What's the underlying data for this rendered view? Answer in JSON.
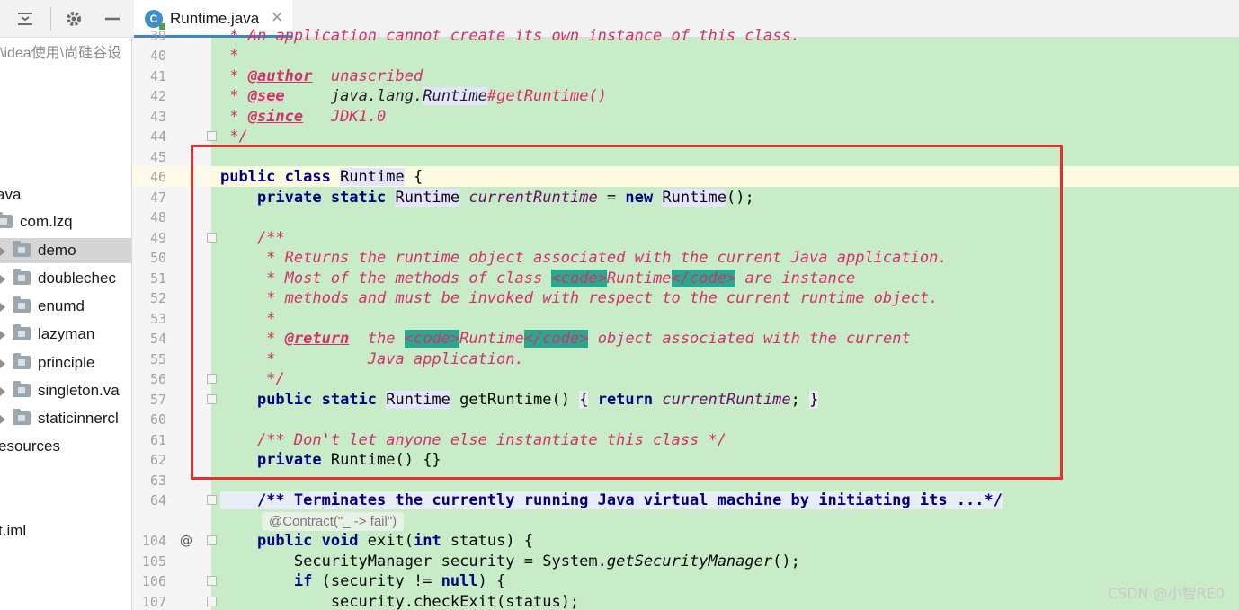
{
  "toolbar": {
    "icons": [
      "collapse-all-icon",
      "gear-icon",
      "minimize-icon"
    ]
  },
  "sidebar": {
    "path": "\\idea使用\\尚硅谷设",
    "items": [
      {
        "label": "ava",
        "kind": "text"
      },
      {
        "label": "com.lzq",
        "kind": "folder-open"
      },
      {
        "label": "demo",
        "kind": "folder",
        "selected": true
      },
      {
        "label": "doublechec",
        "kind": "folder"
      },
      {
        "label": "enumd",
        "kind": "folder"
      },
      {
        "label": "lazyman",
        "kind": "folder"
      },
      {
        "label": "principle",
        "kind": "folder"
      },
      {
        "label": "singleton.va",
        "kind": "folder"
      },
      {
        "label": "staticinnercl",
        "kind": "folder"
      },
      {
        "label": "esources",
        "kind": "text"
      },
      {
        "label": "t.iml",
        "kind": "text"
      }
    ]
  },
  "tab": {
    "title": "Runtime.java",
    "icon_letter": "C",
    "close": "✕"
  },
  "editor": {
    "lines": [
      {
        "n": "39",
        "code": " * An application cannot create its own instance of this class."
      },
      {
        "n": "40",
        "code": " *"
      },
      {
        "n": "41",
        "code": " * @author  unascribed"
      },
      {
        "n": "42",
        "code": " * @see     java.lang.Runtime#getRuntime()"
      },
      {
        "n": "43",
        "code": " * @since   JDK1.0"
      },
      {
        "n": "44",
        "code": " */"
      },
      {
        "n": "45",
        "code": ""
      },
      {
        "n": "46",
        "code": "public class Runtime {"
      },
      {
        "n": "47",
        "code": "    private static Runtime currentRuntime = new Runtime();"
      },
      {
        "n": "48",
        "code": ""
      },
      {
        "n": "49",
        "code": "    /**"
      },
      {
        "n": "50",
        "code": "     * Returns the runtime object associated with the current Java application."
      },
      {
        "n": "51",
        "code": "     * Most of the methods of class <code>Runtime</code> are instance"
      },
      {
        "n": "52",
        "code": "     * methods and must be invoked with respect to the current runtime object."
      },
      {
        "n": "53",
        "code": "     *"
      },
      {
        "n": "54",
        "code": "     * @return  the <code>Runtime</code> object associated with the current"
      },
      {
        "n": "55",
        "code": "     *          Java application."
      },
      {
        "n": "56",
        "code": "     */"
      },
      {
        "n": "57",
        "code": "    public static Runtime getRuntime() { return currentRuntime; }"
      },
      {
        "n": "60",
        "code": ""
      },
      {
        "n": "61",
        "code": "    /** Don't let anyone else instantiate this class */"
      },
      {
        "n": "62",
        "code": "    private Runtime() {}"
      },
      {
        "n": "63",
        "code": ""
      },
      {
        "n": "64",
        "code": "    /** Terminates the currently running Java virtual machine by initiating its ...*/"
      },
      {
        "n": "104",
        "code": "    public void exit(int status) {"
      },
      {
        "n": "105",
        "code": "        SecurityManager security = System.getSecurityManager();"
      },
      {
        "n": "106",
        "code": "        if (security != null) {"
      },
      {
        "n": "107",
        "code": "            security.checkExit(status);"
      }
    ],
    "contract_hint": "@Contract(\"_ -> fail\")",
    "override_marker": "@"
  },
  "watermark": "CSDN @小智RE0",
  "colors": {
    "code_background": "#c8ebc8",
    "keyword": "#000080",
    "doc_comment": "#d6306b",
    "html_tag_highlight": "#2aa78f",
    "highlight_box": "#e03030",
    "tab_underline": "#4083c9"
  }
}
